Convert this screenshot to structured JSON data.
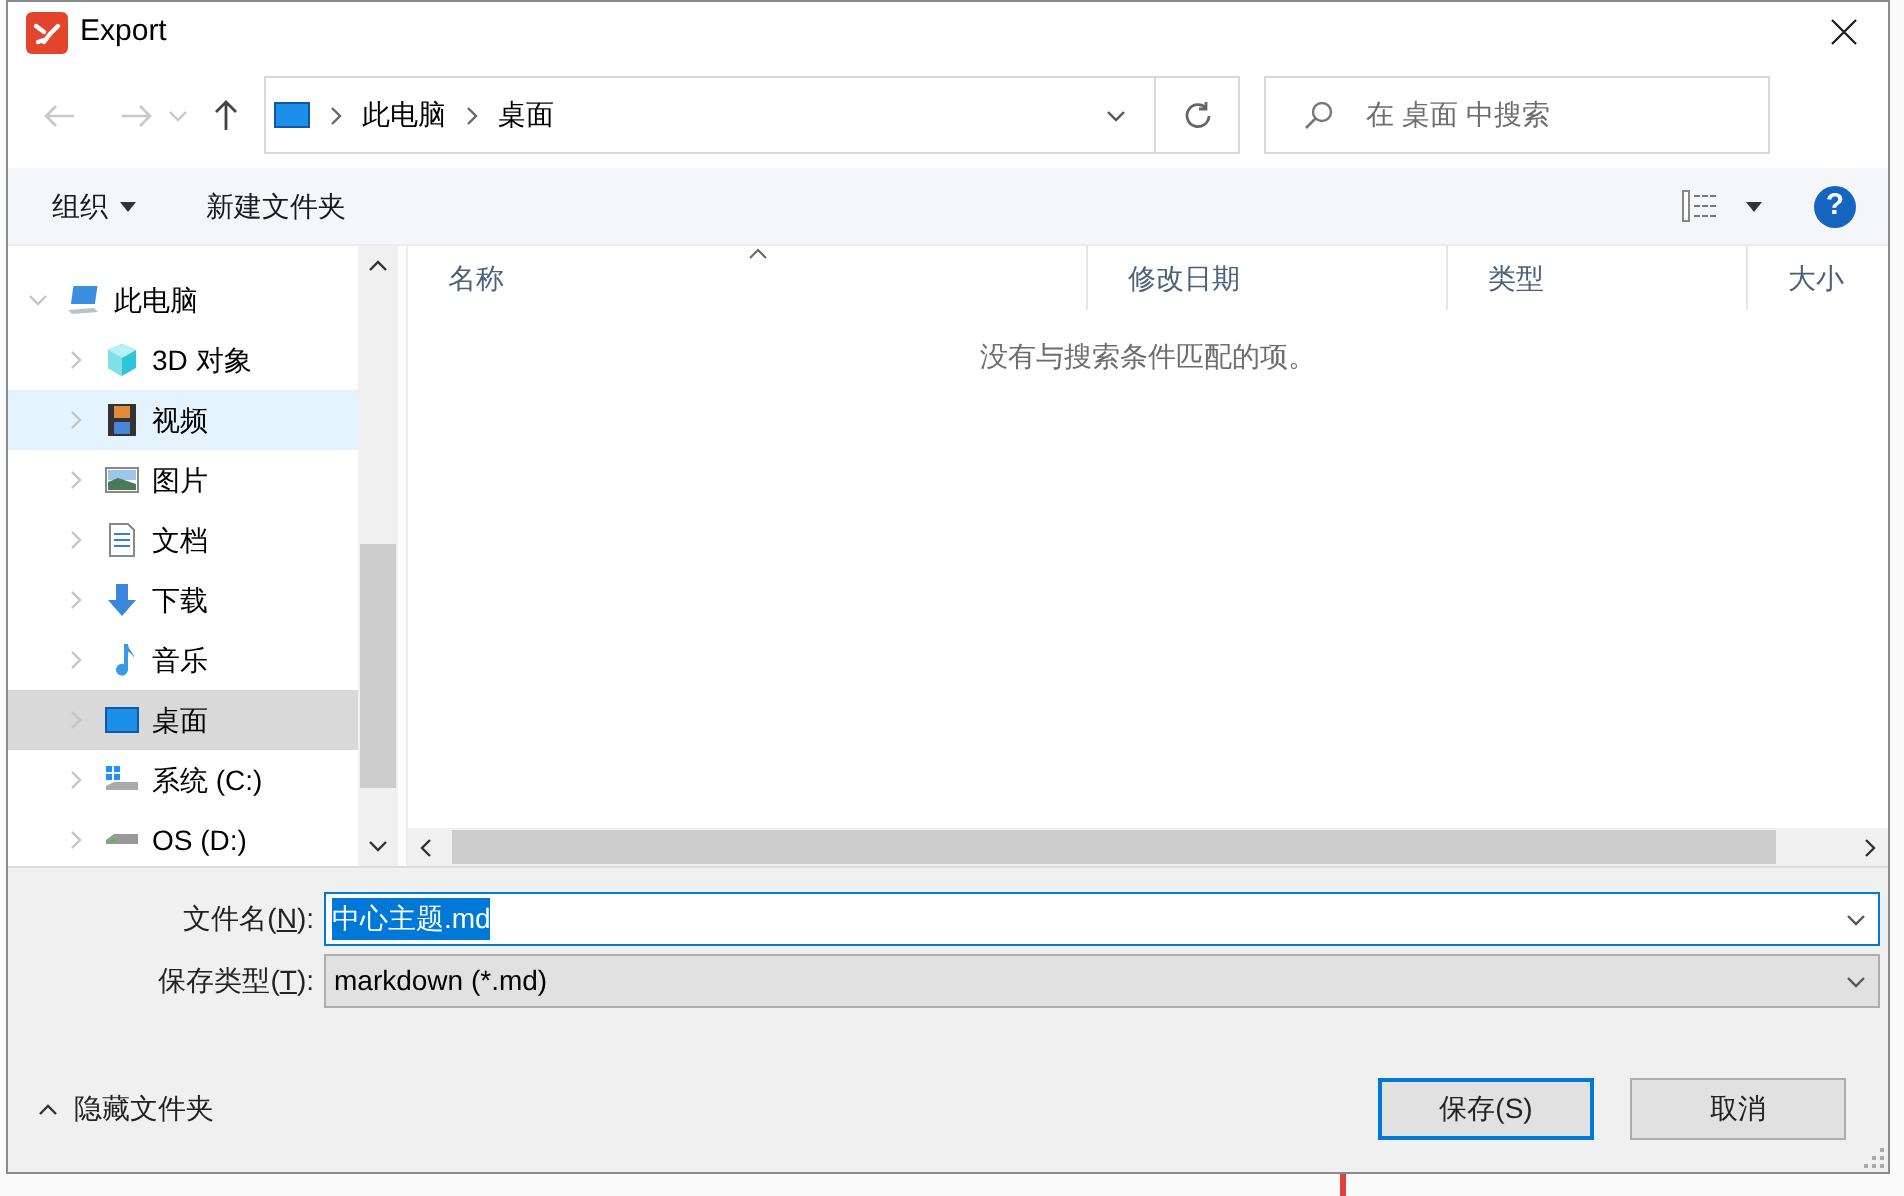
{
  "window": {
    "title": "Export"
  },
  "breadcrumb": [
    {
      "label": "此电脑"
    },
    {
      "label": "桌面"
    }
  ],
  "search": {
    "placeholder": "在 桌面 中搜索"
  },
  "toolbar": {
    "organize": "组织",
    "new_folder": "新建文件夹",
    "help": "?"
  },
  "tree": [
    {
      "label": "此电脑",
      "kind": "pc",
      "expanded": true,
      "selected": false,
      "hovered": false,
      "children": [
        {
          "label": "3D 对象",
          "kind": "cube",
          "expanded": false,
          "selected": false,
          "hovered": false
        },
        {
          "label": "视频",
          "kind": "film",
          "expanded": false,
          "selected": false,
          "hovered": true
        },
        {
          "label": "图片",
          "kind": "picture",
          "expanded": false,
          "selected": false,
          "hovered": false
        },
        {
          "label": "文档",
          "kind": "document",
          "expanded": false,
          "selected": false,
          "hovered": false
        },
        {
          "label": "下载",
          "kind": "download",
          "expanded": false,
          "selected": false,
          "hovered": false
        },
        {
          "label": "音乐",
          "kind": "music",
          "expanded": false,
          "selected": false,
          "hovered": false
        },
        {
          "label": "桌面",
          "kind": "desktop",
          "expanded": false,
          "selected": true,
          "hovered": false
        },
        {
          "label": "系统 (C:)",
          "kind": "system_drive",
          "expanded": false,
          "selected": false,
          "hovered": false
        },
        {
          "label": "OS (D:)",
          "kind": "drive",
          "expanded": false,
          "selected": false,
          "hovered": false
        }
      ]
    }
  ],
  "table": {
    "columns": [
      {
        "label": "名称",
        "sorted": true
      },
      {
        "label": "修改日期",
        "sorted": false
      },
      {
        "label": "类型",
        "sorted": false
      },
      {
        "label": "大小",
        "sorted": false
      }
    ],
    "empty_message": "没有与搜索条件匹配的项。"
  },
  "form": {
    "filename_label": "文件名(**N**):",
    "filename_value": "中心主题.md",
    "filename_text_selected": true,
    "type_label": "保存类型(**T**):",
    "type_value": "markdown (*.md)"
  },
  "hide_folders": "隐藏文件夹",
  "buttons": [
    {
      "label": "保存(S)",
      "default": true
    },
    {
      "label": "取消",
      "default": false
    }
  ]
}
